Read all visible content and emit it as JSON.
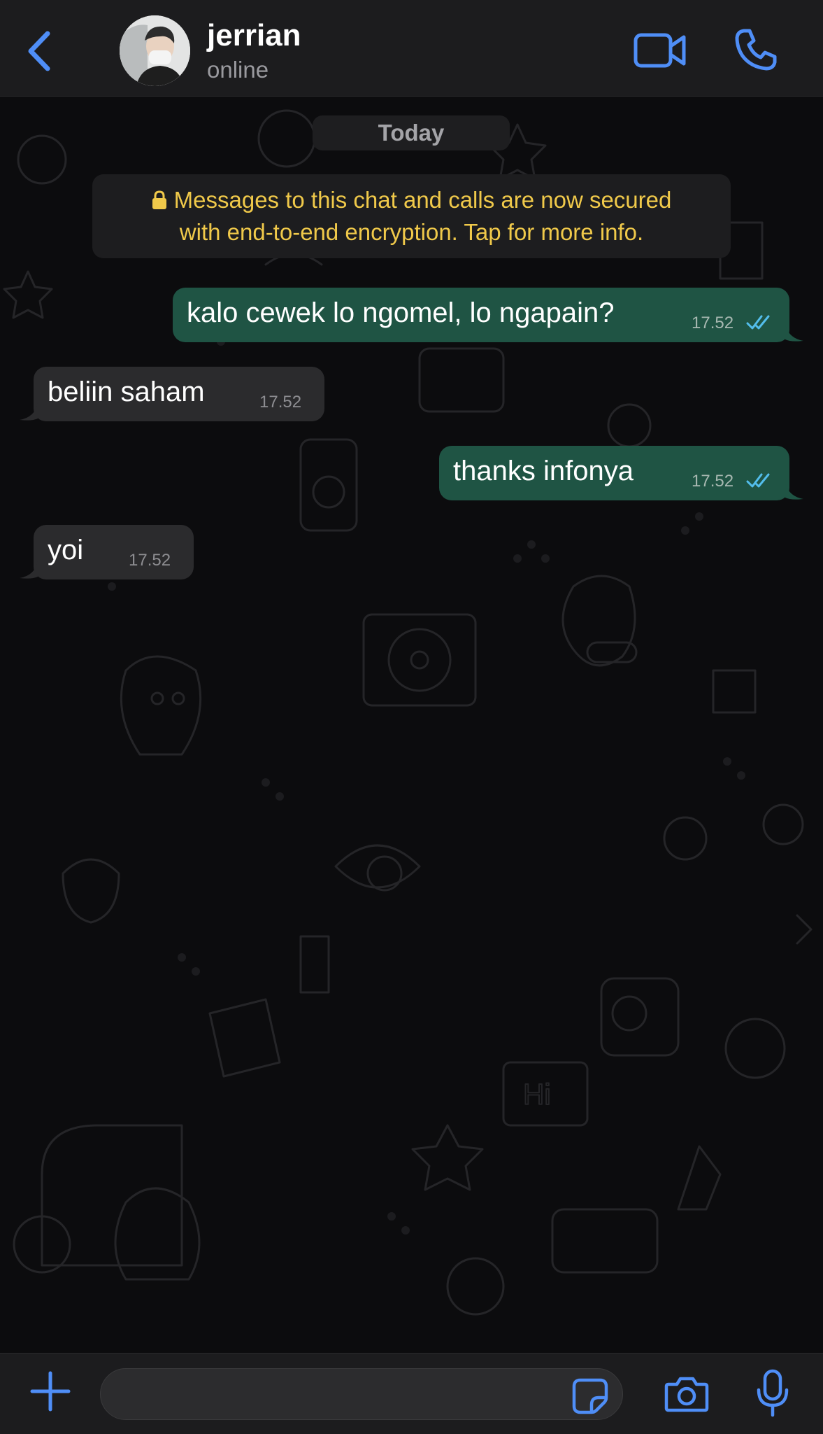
{
  "header": {
    "contact_name": "jerrian",
    "status": "online",
    "icons": {
      "back": "chevron-left-icon",
      "video": "video-camera-icon",
      "call": "phone-icon"
    }
  },
  "chat": {
    "date_label": "Today",
    "encryption_notice": {
      "line1": "Messages to this chat and calls are now secured",
      "line2": "with end-to-end encryption. Tap for more info."
    },
    "messages": [
      {
        "direction": "outgoing",
        "text": "kalo cewek lo ngomel, lo ngapain?",
        "time": "17.52",
        "status": "read"
      },
      {
        "direction": "incoming",
        "text": "beliin saham",
        "time": "17.52"
      },
      {
        "direction": "outgoing",
        "text": "thanks infonya",
        "time": "17.52",
        "status": "read"
      },
      {
        "direction": "incoming",
        "text": "yoi",
        "time": "17.52"
      }
    ]
  },
  "composer": {
    "placeholder": "",
    "icons": {
      "attach": "plus-icon",
      "sticker": "sticker-icon",
      "camera": "camera-icon",
      "mic": "microphone-icon"
    }
  },
  "colors": {
    "accent": "#4f8ef7",
    "outgoing_bubble": "#1f5444",
    "incoming_bubble": "#2b2b2d",
    "notice_text": "#f0c94a",
    "read_ticks": "#53bdeb"
  }
}
